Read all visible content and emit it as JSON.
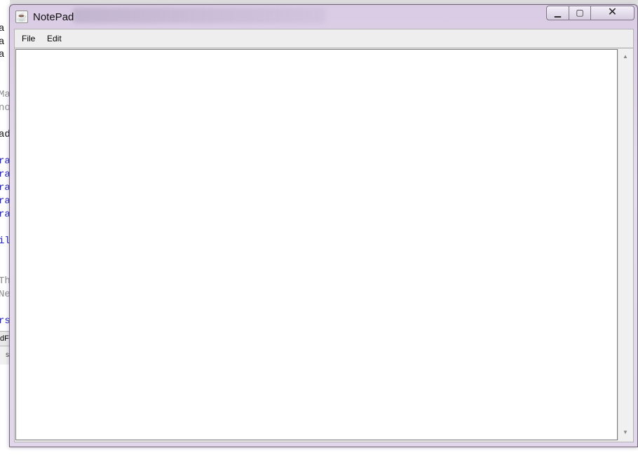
{
  "window": {
    "title": "NotePad",
    "app_icon_glyph": "☕"
  },
  "title_controls": {
    "minimize_glyph": "▁",
    "maximize_glyph": "▢",
    "close_glyph": "✕"
  },
  "menubar": {
    "items": [
      {
        "label": "File"
      },
      {
        "label": "Edit"
      }
    ]
  },
  "editor": {
    "content": ""
  },
  "scrollbar": {
    "up_glyph": "▲",
    "down_glyph": "▼"
  },
  "background_editor": {
    "visible_fragments": [
      {
        "text": "a"
      },
      {
        "text": "a"
      },
      {
        "text": "a"
      },
      {
        "text": "Ma"
      },
      {
        "text": "no"
      },
      {
        "text": "ad"
      },
      {
        "text": "ra"
      },
      {
        "text": "ra"
      },
      {
        "text": "ra"
      },
      {
        "text": "ra"
      },
      {
        "text": "ra"
      },
      {
        "text": "il"
      },
      {
        "text": "Th"
      },
      {
        "text": "Ne"
      },
      {
        "text": "rs"
      }
    ],
    "tab_fragment": "dF",
    "status_fragment": "s"
  },
  "colors": {
    "window_frame": "#e2d6ea",
    "editor_bg": "#ffffff",
    "menubar_bg": "#eeeeee",
    "code_keyword_blue": "#2323c8",
    "code_comment_grey": "#8a8a8a"
  }
}
